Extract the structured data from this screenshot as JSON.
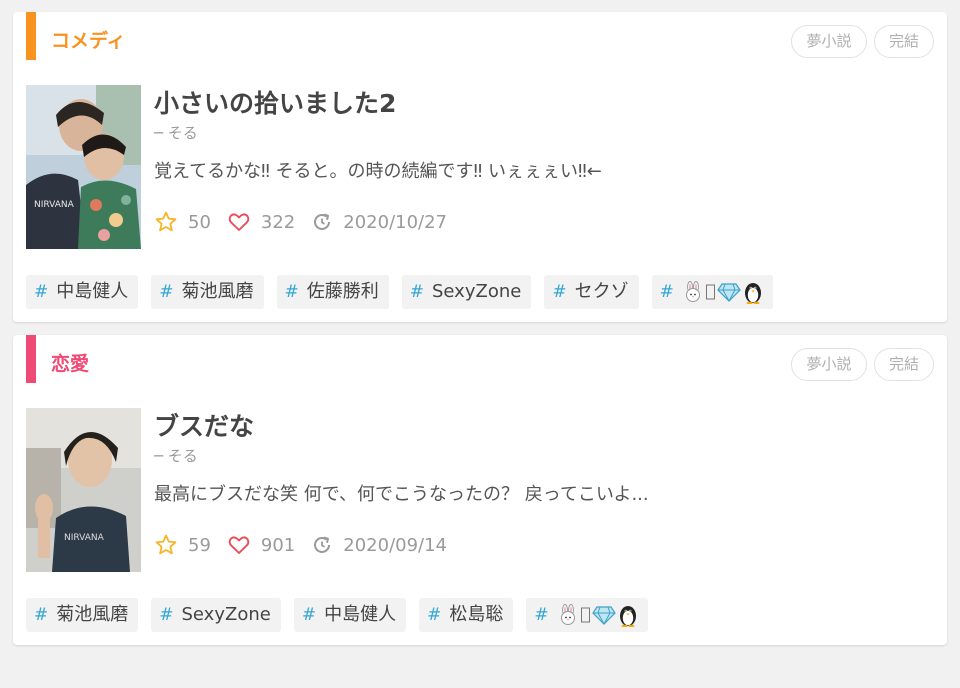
{
  "colors": {
    "comedy": "#f7931e",
    "romance": "#ef4a75",
    "tag_hash": "#34a6d6",
    "star": "#f5b525",
    "heart": "#ea4c5c"
  },
  "cards": [
    {
      "genre": "コメディ",
      "badges": [
        "夢小説",
        "完結"
      ],
      "title": "小さいの拾いました2",
      "author": "─ そる",
      "summary": "覚えてるかな‼︎ そると。の時の続編です‼︎ いぇぇぇい‼︎←",
      "stars": "50",
      "likes": "322",
      "updated": "2020/10/27",
      "tags": [
        "中島健人",
        "菊池風磨",
        "佐藤勝利",
        "SexyZone",
        "セクゾ"
      ],
      "emoji_tag_icons": [
        "rabbit-icon",
        "star-icon",
        "gem-icon",
        "penguin-icon"
      ]
    },
    {
      "genre": "恋愛",
      "badges": [
        "夢小説",
        "完結"
      ],
      "title": "ブスだな",
      "author": "─ そる",
      "summary": "最高にブスだな笑 何で、何でこうなったの？ 戻ってこいよ...",
      "stars": "59",
      "likes": "901",
      "updated": "2020/09/14",
      "tags": [
        "菊池風磨",
        "SexyZone",
        "中島健人",
        "松島聡"
      ],
      "emoji_tag_icons": [
        "rabbit-icon",
        "star-icon",
        "gem-icon",
        "penguin-icon"
      ]
    }
  ]
}
